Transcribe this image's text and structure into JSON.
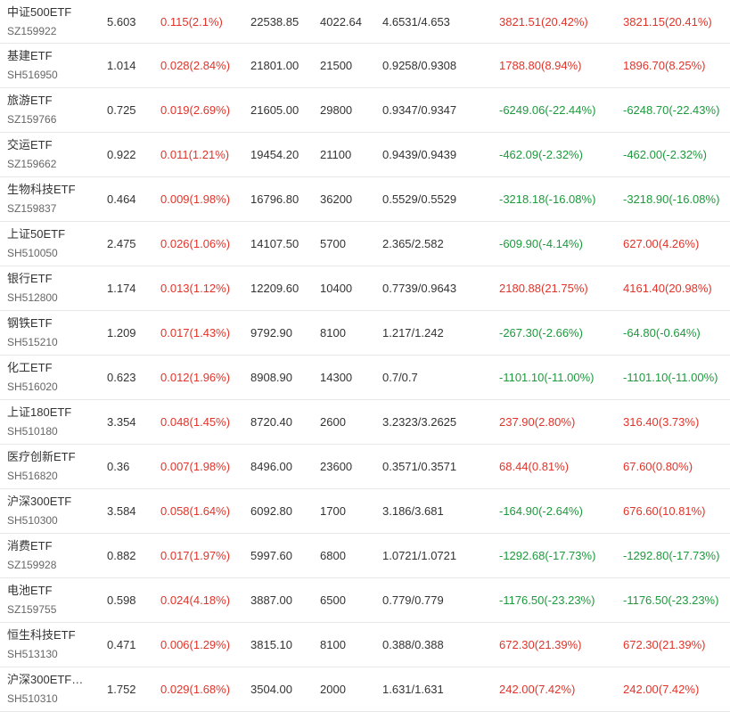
{
  "colors": {
    "up": "#e0342a",
    "down": "#1c9a3c",
    "text": "#333333",
    "code": "#666666",
    "divider": "#e8e8e8"
  },
  "rows": [
    {
      "name": "中证500ETF",
      "code": "SZ159922",
      "price": "5.603",
      "change": "0.115(2.1%)",
      "amount": "22538.85",
      "volume": "4022.64",
      "range": "4.6531/4.653",
      "pl1": "3821.51(20.42%)",
      "pl1_dir": "up",
      "pl2": "3821.15(20.41%)",
      "pl2_dir": "up"
    },
    {
      "name": "基建ETF",
      "code": "SH516950",
      "price": "1.014",
      "change": "0.028(2.84%)",
      "amount": "21801.00",
      "volume": "21500",
      "range": "0.9258/0.9308",
      "pl1": "1788.80(8.94%)",
      "pl1_dir": "up",
      "pl2": "1896.70(8.25%)",
      "pl2_dir": "up"
    },
    {
      "name": "旅游ETF",
      "code": "SZ159766",
      "price": "0.725",
      "change": "0.019(2.69%)",
      "amount": "21605.00",
      "volume": "29800",
      "range": "0.9347/0.9347",
      "pl1": "-6249.06(-22.44%)",
      "pl1_dir": "down",
      "pl2": "-6248.70(-22.43%)",
      "pl2_dir": "down"
    },
    {
      "name": "交运ETF",
      "code": "SZ159662",
      "price": "0.922",
      "change": "0.011(1.21%)",
      "amount": "19454.20",
      "volume": "21100",
      "range": "0.9439/0.9439",
      "pl1": "-462.09(-2.32%)",
      "pl1_dir": "down",
      "pl2": "-462.00(-2.32%)",
      "pl2_dir": "down"
    },
    {
      "name": "生物科技ETF",
      "code": "SZ159837",
      "price": "0.464",
      "change": "0.009(1.98%)",
      "amount": "16796.80",
      "volume": "36200",
      "range": "0.5529/0.5529",
      "pl1": "-3218.18(-16.08%)",
      "pl1_dir": "down",
      "pl2": "-3218.90(-16.08%)",
      "pl2_dir": "down"
    },
    {
      "name": "上证50ETF",
      "code": "SH510050",
      "price": "2.475",
      "change": "0.026(1.06%)",
      "amount": "14107.50",
      "volume": "5700",
      "range": "2.365/2.582",
      "pl1": "-609.90(-4.14%)",
      "pl1_dir": "down",
      "pl2": "627.00(4.26%)",
      "pl2_dir": "up"
    },
    {
      "name": "银行ETF",
      "code": "SH512800",
      "price": "1.174",
      "change": "0.013(1.12%)",
      "amount": "12209.60",
      "volume": "10400",
      "range": "0.7739/0.9643",
      "pl1": "2180.88(21.75%)",
      "pl1_dir": "up",
      "pl2": "4161.40(20.98%)",
      "pl2_dir": "up"
    },
    {
      "name": "钢铁ETF",
      "code": "SH515210",
      "price": "1.209",
      "change": "0.017(1.43%)",
      "amount": "9792.90",
      "volume": "8100",
      "range": "1.217/1.242",
      "pl1": "-267.30(-2.66%)",
      "pl1_dir": "down",
      "pl2": "-64.80(-0.64%)",
      "pl2_dir": "down"
    },
    {
      "name": "化工ETF",
      "code": "SH516020",
      "price": "0.623",
      "change": "0.012(1.96%)",
      "amount": "8908.90",
      "volume": "14300",
      "range": "0.7/0.7",
      "pl1": "-1101.10(-11.00%)",
      "pl1_dir": "down",
      "pl2": "-1101.10(-11.00%)",
      "pl2_dir": "down"
    },
    {
      "name": "上证180ETF",
      "code": "SH510180",
      "price": "3.354",
      "change": "0.048(1.45%)",
      "amount": "8720.40",
      "volume": "2600",
      "range": "3.2323/3.2625",
      "pl1": "237.90(2.80%)",
      "pl1_dir": "up",
      "pl2": "316.40(3.73%)",
      "pl2_dir": "up"
    },
    {
      "name": "医疗创新ETF",
      "code": "SH516820",
      "price": "0.36",
      "change": "0.007(1.98%)",
      "amount": "8496.00",
      "volume": "23600",
      "range": "0.3571/0.3571",
      "pl1": "68.44(0.81%)",
      "pl1_dir": "up",
      "pl2": "67.60(0.80%)",
      "pl2_dir": "up"
    },
    {
      "name": "沪深300ETF",
      "code": "SH510300",
      "price": "3.584",
      "change": "0.058(1.64%)",
      "amount": "6092.80",
      "volume": "1700",
      "range": "3.186/3.681",
      "pl1": "-164.90(-2.64%)",
      "pl1_dir": "down",
      "pl2": "676.60(10.81%)",
      "pl2_dir": "up"
    },
    {
      "name": "消费ETF",
      "code": "SZ159928",
      "price": "0.882",
      "change": "0.017(1.97%)",
      "amount": "5997.60",
      "volume": "6800",
      "range": "1.0721/1.0721",
      "pl1": "-1292.68(-17.73%)",
      "pl1_dir": "down",
      "pl2": "-1292.80(-17.73%)",
      "pl2_dir": "down"
    },
    {
      "name": "电池ETF",
      "code": "SZ159755",
      "price": "0.598",
      "change": "0.024(4.18%)",
      "amount": "3887.00",
      "volume": "6500",
      "range": "0.779/0.779",
      "pl1": "-1176.50(-23.23%)",
      "pl1_dir": "down",
      "pl2": "-1176.50(-23.23%)",
      "pl2_dir": "down"
    },
    {
      "name": "恒生科技ETF",
      "code": "SH513130",
      "price": "0.471",
      "change": "0.006(1.29%)",
      "amount": "3815.10",
      "volume": "8100",
      "range": "0.388/0.388",
      "pl1": "672.30(21.39%)",
      "pl1_dir": "up",
      "pl2": "672.30(21.39%)",
      "pl2_dir": "up"
    },
    {
      "name": "沪深300ETF…",
      "code": "SH510310",
      "price": "1.752",
      "change": "0.029(1.68%)",
      "amount": "3504.00",
      "volume": "2000",
      "range": "1.631/1.631",
      "pl1": "242.00(7.42%)",
      "pl1_dir": "up",
      "pl2": "242.00(7.42%)",
      "pl2_dir": "up"
    }
  ]
}
